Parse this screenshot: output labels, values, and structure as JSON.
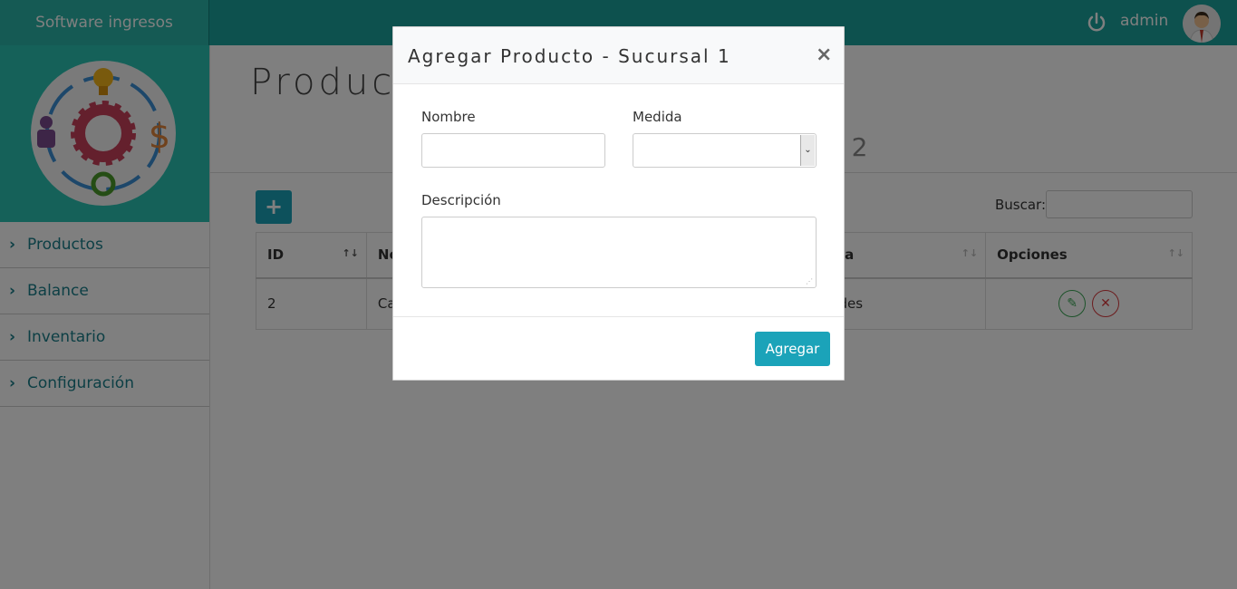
{
  "app": {
    "brand": "Software ingresos",
    "user": "admin"
  },
  "sidebar": {
    "items": [
      {
        "label": "Productos"
      },
      {
        "label": "Balance"
      },
      {
        "label": "Inventario"
      },
      {
        "label": "Configuración"
      }
    ]
  },
  "page": {
    "title": "Product",
    "subtitle_fragment": "l 2"
  },
  "toolbar": {
    "add_label": "+",
    "search_label": "Buscar:",
    "search_value": ""
  },
  "table": {
    "columns": [
      {
        "label": "ID"
      },
      {
        "label": "No"
      },
      {
        "label": "ida"
      },
      {
        "label": "Opciones"
      }
    ],
    "rows": [
      {
        "id": "2",
        "nombre": "Ca",
        "medida": "ades"
      }
    ]
  },
  "modal": {
    "title": "Agregar Producto - Sucursal 1",
    "close_label": "×",
    "nombre_label": "Nombre",
    "nombre_value": "",
    "medida_label": "Medida",
    "medida_value": "",
    "descripcion_label": "Descripción",
    "descripcion_value": "",
    "submit_label": "Agregar"
  },
  "colors": {
    "topbar": "#1ba39c",
    "logo_bg": "#2bc3b3",
    "link": "#1a7f8a",
    "primary_button": "#1ba3b9",
    "edit": "#3aa655",
    "delete": "#d9383c"
  }
}
